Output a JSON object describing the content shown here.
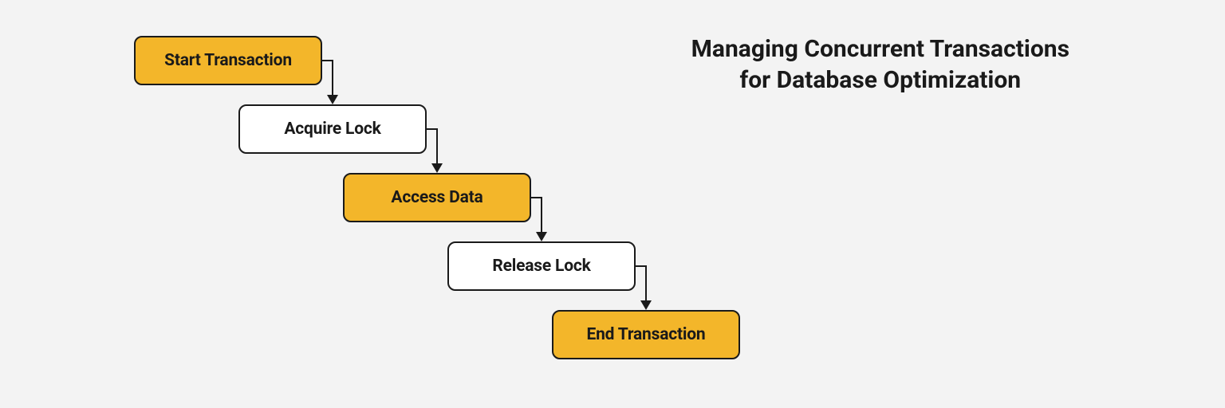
{
  "heading": {
    "line1": "Managing Concurrent Transactions",
    "line2": "for Database Optimization"
  },
  "nodes": [
    {
      "id": "start-transaction",
      "label": "Start Transaction",
      "variant": "yellow"
    },
    {
      "id": "acquire-lock",
      "label": "Acquire Lock",
      "variant": "white"
    },
    {
      "id": "access-data",
      "label": "Access Data",
      "variant": "yellow"
    },
    {
      "id": "release-lock",
      "label": "Release Lock",
      "variant": "white"
    },
    {
      "id": "end-transaction",
      "label": "End Transaction",
      "variant": "yellow"
    }
  ],
  "layout": {
    "startLeft": 168,
    "startTop": 45,
    "stepX": 131,
    "stepY": 86,
    "nodeWidth": 236,
    "nodeHeight": 62
  }
}
